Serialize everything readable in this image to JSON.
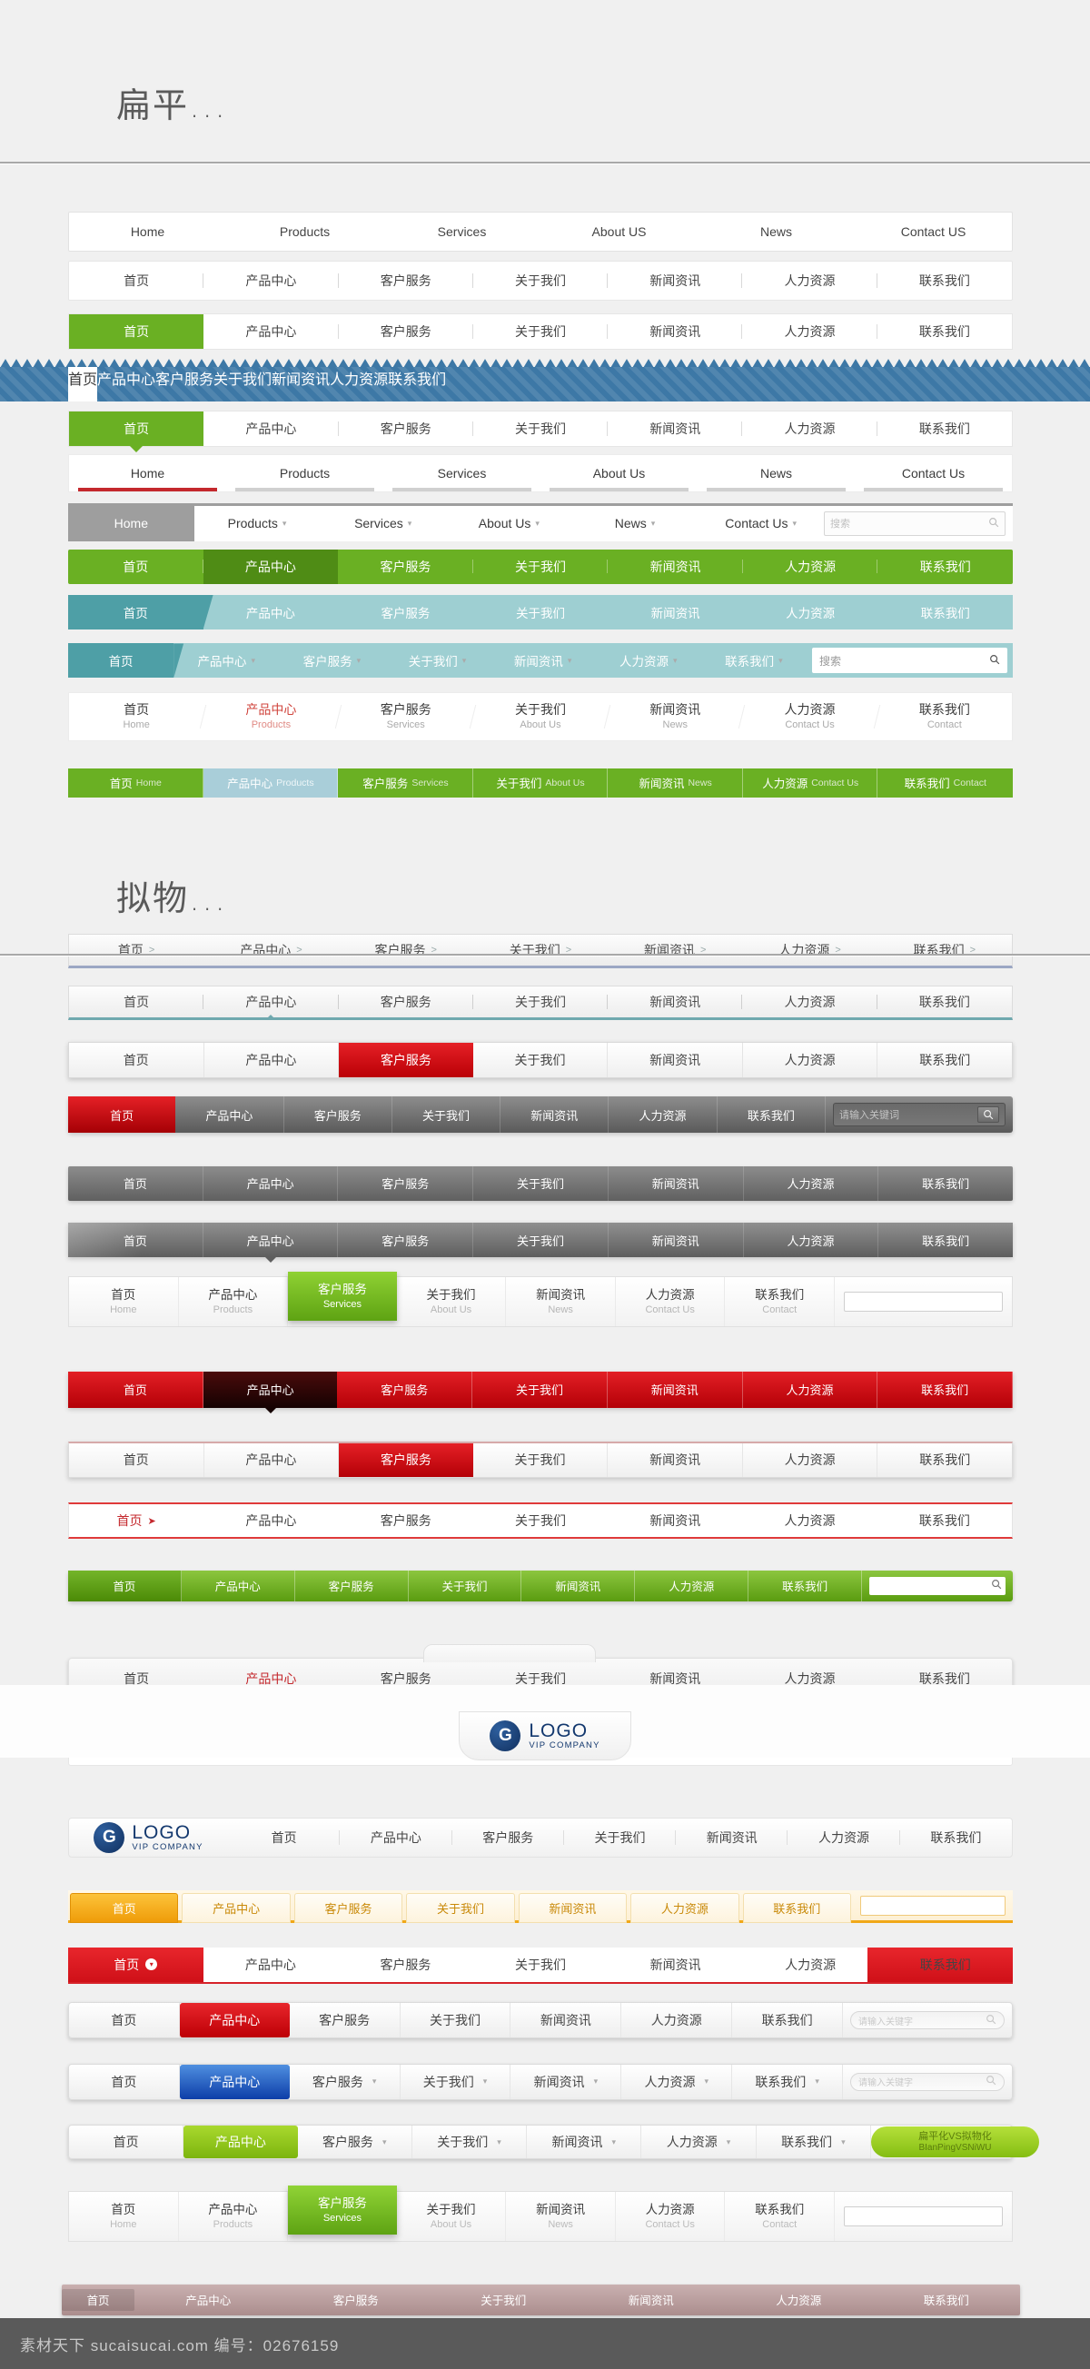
{
  "sections": {
    "flat_heading": "扁平...",
    "skeuo_heading": "拟物..."
  },
  "labels": {
    "zh": [
      "首页",
      "产品中心",
      "客户服务",
      "关于我们",
      "新闻资讯",
      "人力资源",
      "联系我们"
    ],
    "en_us": [
      "Home",
      "Products",
      "Services",
      "About US",
      "News",
      "Contact US"
    ],
    "en_mixed": [
      "Home",
      "Products",
      "Services",
      "About Us",
      "News",
      "Contact Us"
    ],
    "en_sub": [
      "Home",
      "Products",
      "Services",
      "About Us",
      "News",
      "Contact Us",
      "Contact"
    ]
  },
  "navs": [
    {
      "id": "nav-english-plain",
      "style": "n1",
      "items": [
        {
          "zh": "Home"
        },
        {
          "zh": "Products"
        },
        {
          "zh": "Services"
        },
        {
          "zh": "About US"
        },
        {
          "zh": "News"
        },
        {
          "zh": "Contact US"
        }
      ]
    },
    {
      "id": "nav-chinese-divider",
      "style": "n2",
      "items": [
        {
          "zh": "首页"
        },
        {
          "zh": "产品中心"
        },
        {
          "zh": "客户服务"
        },
        {
          "zh": "关于我们"
        },
        {
          "zh": "新闻资讯"
        },
        {
          "zh": "人力资源"
        },
        {
          "zh": "联系我们"
        }
      ]
    },
    {
      "id": "nav-green-active",
      "style": "n3",
      "items": [
        {
          "zh": "首页",
          "active": true
        },
        {
          "zh": "产品中心"
        },
        {
          "zh": "客户服务"
        },
        {
          "zh": "关于我们"
        },
        {
          "zh": "新闻资讯"
        },
        {
          "zh": "人力资源"
        },
        {
          "zh": "联系我们"
        }
      ]
    },
    {
      "id": "nav-blue-zigzag",
      "style": "n4",
      "items": [
        {
          "zh": "首页",
          "active": true
        },
        {
          "zh": "产品中心"
        },
        {
          "zh": "客户服务"
        },
        {
          "zh": "关于我们"
        },
        {
          "zh": "新闻资讯"
        },
        {
          "zh": "人力资源"
        },
        {
          "zh": "联系我们"
        }
      ]
    },
    {
      "id": "nav-green-arrow",
      "style": "n5",
      "items": [
        {
          "zh": "首页",
          "active": true
        },
        {
          "zh": "产品中心"
        },
        {
          "zh": "客户服务"
        },
        {
          "zh": "关于我们"
        },
        {
          "zh": "新闻资讯"
        },
        {
          "zh": "人力资源"
        },
        {
          "zh": "联系我们"
        }
      ]
    },
    {
      "id": "nav-english-underline",
      "style": "n6",
      "items": [
        {
          "zh": "Home",
          "active": true
        },
        {
          "zh": "Products"
        },
        {
          "zh": "Services"
        },
        {
          "zh": "About Us"
        },
        {
          "zh": "News"
        },
        {
          "zh": "Contact Us"
        }
      ]
    },
    {
      "id": "nav-english-dropdown-search",
      "style": "n7",
      "search": {
        "placeholder": "搜索"
      },
      "items": [
        {
          "zh": "Home",
          "active": true
        },
        {
          "zh": "Products",
          "caret": true
        },
        {
          "zh": "Services",
          "caret": true
        },
        {
          "zh": "About Us",
          "caret": true
        },
        {
          "zh": "News",
          "caret": true
        },
        {
          "zh": "Contact Us",
          "caret": true
        }
      ]
    },
    {
      "id": "nav-solid-green",
      "style": "n8",
      "items": [
        {
          "zh": "首页"
        },
        {
          "zh": "产品中心",
          "active": true
        },
        {
          "zh": "客户服务"
        },
        {
          "zh": "关于我们"
        },
        {
          "zh": "新闻资讯"
        },
        {
          "zh": "人力资源"
        },
        {
          "zh": "联系我们"
        }
      ]
    },
    {
      "id": "nav-teal-arrow",
      "style": "n9",
      "items": [
        {
          "zh": "首页",
          "active": true
        },
        {
          "zh": "产品中心"
        },
        {
          "zh": "客户服务"
        },
        {
          "zh": "关于我们"
        },
        {
          "zh": "新闻资讯"
        },
        {
          "zh": "人力资源"
        },
        {
          "zh": "联系我们"
        }
      ]
    },
    {
      "id": "nav-teal-search",
      "style": "n10",
      "search": {
        "placeholder": "搜索"
      },
      "items": [
        {
          "zh": "首页",
          "active": true
        },
        {
          "zh": "产品中心",
          "caret": true
        },
        {
          "zh": "客户服务",
          "caret": true
        },
        {
          "zh": "关于我们",
          "caret": true
        },
        {
          "zh": "新闻资讯",
          "caret": true
        },
        {
          "zh": "人力资源",
          "caret": true
        },
        {
          "zh": "联系我们",
          "caret": true
        }
      ]
    },
    {
      "id": "nav-bilingual-stacked",
      "style": "n11",
      "items": [
        {
          "zh": "首页",
          "en": "Home"
        },
        {
          "zh": "产品中心",
          "en": "Products",
          "active": true
        },
        {
          "zh": "客户服务",
          "en": "Services"
        },
        {
          "zh": "关于我们",
          "en": "About Us"
        },
        {
          "zh": "新闻资讯",
          "en": "News"
        },
        {
          "zh": "人力资源",
          "en": "Contact Us"
        },
        {
          "zh": "联系我们",
          "en": "Contact"
        }
      ]
    },
    {
      "id": "nav-green-bilingual-inline",
      "style": "n12",
      "items": [
        {
          "zh": "首页",
          "en": "Home"
        },
        {
          "zh": "产品中心",
          "en": "Products",
          "active": true
        },
        {
          "zh": "客户服务",
          "en": "Services"
        },
        {
          "zh": "关于我们",
          "en": "About Us"
        },
        {
          "zh": "新闻资讯",
          "en": "News"
        },
        {
          "zh": "人力资源",
          "en": "Contact Us"
        },
        {
          "zh": "联系我们",
          "en": "Contact"
        }
      ]
    },
    {
      "id": "nav-skeuo-chevron",
      "style": "s1",
      "items": [
        {
          "zh": "首页",
          "gt": true
        },
        {
          "zh": "产品中心",
          "gt": true
        },
        {
          "zh": "客户服务",
          "gt": true
        },
        {
          "zh": "关于我们",
          "gt": true
        },
        {
          "zh": "新闻资讯",
          "gt": true
        },
        {
          "zh": "人力资源",
          "gt": true
        },
        {
          "zh": "联系我们",
          "gt": true
        }
      ]
    },
    {
      "id": "nav-skeuo-teal-caret",
      "style": "s2",
      "items": [
        {
          "zh": "首页"
        },
        {
          "zh": "产品中心",
          "active": true
        },
        {
          "zh": "客户服务"
        },
        {
          "zh": "关于我们"
        },
        {
          "zh": "新闻资讯"
        },
        {
          "zh": "人力资源"
        },
        {
          "zh": "联系我们"
        }
      ]
    },
    {
      "id": "nav-skeuo-white-red",
      "style": "s3",
      "items": [
        {
          "zh": "首页"
        },
        {
          "zh": "产品中心"
        },
        {
          "zh": "客户服务",
          "active": true
        },
        {
          "zh": "关于我们"
        },
        {
          "zh": "新闻资讯"
        },
        {
          "zh": "人力资源"
        },
        {
          "zh": "联系我们"
        }
      ]
    },
    {
      "id": "nav-skeuo-dark-red-search",
      "style": "s4",
      "search": {
        "placeholder": "请输入关键词"
      },
      "items": [
        {
          "zh": "首页",
          "active": true
        },
        {
          "zh": "产品中心"
        },
        {
          "zh": "客户服务"
        },
        {
          "zh": "关于我们"
        },
        {
          "zh": "新闻资讯"
        },
        {
          "zh": "人力资源"
        },
        {
          "zh": "联系我们"
        }
      ]
    },
    {
      "id": "nav-skeuo-gray",
      "style": "s5",
      "items": [
        {
          "zh": "首页"
        },
        {
          "zh": "产品中心"
        },
        {
          "zh": "客户服务"
        },
        {
          "zh": "关于我们"
        },
        {
          "zh": "新闻资讯"
        },
        {
          "zh": "人力资源"
        },
        {
          "zh": "联系我们"
        }
      ]
    },
    {
      "id": "nav-skeuo-gray-gloss",
      "style": "s6",
      "items": [
        {
          "zh": "首页"
        },
        {
          "zh": "产品中心",
          "active": true
        },
        {
          "zh": "客户服务"
        },
        {
          "zh": "关于我们"
        },
        {
          "zh": "新闻资讯"
        },
        {
          "zh": "人力资源"
        },
        {
          "zh": "联系我们"
        }
      ]
    },
    {
      "id": "nav-skeuo-bilingual-green",
      "style": "s7",
      "items": [
        {
          "zh": "首页",
          "en": "Home"
        },
        {
          "zh": "产品中心",
          "en": "Products"
        },
        {
          "zh": "客户服务",
          "en": "Services",
          "active": true
        },
        {
          "zh": "关于我们",
          "en": "About Us"
        },
        {
          "zh": "新闻资讯",
          "en": "News"
        },
        {
          "zh": "人力资源",
          "en": "Contact Us"
        },
        {
          "zh": "联系我们",
          "en": "Contact"
        }
      ]
    },
    {
      "id": "nav-skeuo-red-black",
      "style": "s8",
      "items": [
        {
          "zh": "首页"
        },
        {
          "zh": "产品中心",
          "active": true
        },
        {
          "zh": "客户服务"
        },
        {
          "zh": "关于我们"
        },
        {
          "zh": "新闻资讯"
        },
        {
          "zh": "人力资源"
        },
        {
          "zh": "联系我们"
        }
      ]
    },
    {
      "id": "nav-skeuo-white-red2",
      "style": "s9",
      "items": [
        {
          "zh": "首页"
        },
        {
          "zh": "产品中心"
        },
        {
          "zh": "客户服务",
          "active": true
        },
        {
          "zh": "关于我们"
        },
        {
          "zh": "新闻资讯"
        },
        {
          "zh": "人力资源"
        },
        {
          "zh": "联系我们"
        }
      ]
    },
    {
      "id": "nav-skeuo-red-ribbon",
      "style": "s10",
      "items": [
        {
          "zh": "首页",
          "active": true,
          "badge": "➤"
        },
        {
          "zh": "产品中心"
        },
        {
          "zh": "客户服务"
        },
        {
          "zh": "关于我们"
        },
        {
          "zh": "新闻资讯"
        },
        {
          "zh": "人力资源"
        },
        {
          "zh": "联系我们"
        }
      ]
    },
    {
      "id": "nav-skeuo-green-gloss-search",
      "style": "s11",
      "search": {
        "placeholder": ""
      },
      "items": [
        {
          "zh": "首页",
          "active": true
        },
        {
          "zh": "产品中心"
        },
        {
          "zh": "客户服务"
        },
        {
          "zh": "关于我们"
        },
        {
          "zh": "新闻资讯"
        },
        {
          "zh": "人力资源"
        },
        {
          "zh": "联系我们"
        }
      ]
    },
    {
      "id": "nav-skeuo-rounded-tab",
      "style": "s12",
      "items": [
        {
          "zh": "首页"
        },
        {
          "zh": "产品中心",
          "active": true
        },
        {
          "zh": "客户服务"
        },
        {
          "zh": "关于我们"
        },
        {
          "zh": "新闻资讯"
        },
        {
          "zh": "人力资源"
        },
        {
          "zh": "联系我们"
        }
      ]
    },
    {
      "id": "nav-skeuo-logo-center",
      "style": "s13",
      "logo": {
        "name": "LOGO",
        "tagline": "VIP COMPANY",
        "mark": "G"
      },
      "items": [
        {
          "zh": "产品中心",
          "active": true
        },
        {
          "zh": "客户服务"
        },
        {
          "zh": "关于我们"
        },
        {
          "zh": "新闻资讯"
        },
        {
          "zh": "人力资源"
        },
        {
          "zh": "联系我们"
        }
      ]
    },
    {
      "id": "nav-skeuo-logo-left",
      "style": "s14",
      "logo": {
        "name": "LOGO",
        "tagline": "VIP COMPANY",
        "mark": "G"
      },
      "items": [
        {
          "zh": "首页"
        },
        {
          "zh": "产品中心"
        },
        {
          "zh": "客户服务"
        },
        {
          "zh": "关于我们"
        },
        {
          "zh": "新闻资讯"
        },
        {
          "zh": "人力资源"
        },
        {
          "zh": "联系我们"
        }
      ]
    },
    {
      "id": "nav-skeuo-orange-tabs",
      "style": "s15",
      "search": {
        "placeholder": ""
      },
      "items": [
        {
          "zh": "首页",
          "active": true
        },
        {
          "zh": "产品中心"
        },
        {
          "zh": "客户服务"
        },
        {
          "zh": "关于我们"
        },
        {
          "zh": "新闻资讯"
        },
        {
          "zh": "人力资源"
        },
        {
          "zh": "联系我们"
        }
      ]
    },
    {
      "id": "nav-skeuo-red-dot-tab",
      "style": "s16",
      "items": [
        {
          "zh": "首页",
          "active": true,
          "dot": "▾"
        },
        {
          "zh": "产品中心"
        },
        {
          "zh": "客户服务"
        },
        {
          "zh": "关于我们"
        },
        {
          "zh": "新闻资讯"
        },
        {
          "zh": "人力资源"
        },
        {
          "zh": "联系我们"
        }
      ]
    },
    {
      "id": "nav-skeuo-red-active-search",
      "style": "s17",
      "search": {
        "placeholder": "请输入关键字"
      },
      "items": [
        {
          "zh": "首页"
        },
        {
          "zh": "产品中心",
          "active": true
        },
        {
          "zh": "客户服务"
        },
        {
          "zh": "关于我们"
        },
        {
          "zh": "新闻资讯"
        },
        {
          "zh": "人力资源"
        },
        {
          "zh": "联系我们"
        }
      ]
    },
    {
      "id": "nav-skeuo-blue-active-search",
      "style": "s18",
      "search": {
        "placeholder": "请输入关键字"
      },
      "items": [
        {
          "zh": "首页"
        },
        {
          "zh": "产品中心",
          "active": true
        },
        {
          "zh": "客户服务",
          "caret": true
        },
        {
          "zh": "关于我们",
          "caret": true
        },
        {
          "zh": "新闻资讯",
          "caret": true
        },
        {
          "zh": "人力资源",
          "caret": true
        },
        {
          "zh": "联系我们",
          "caret": true
        }
      ]
    },
    {
      "id": "nav-skeuo-green-pill",
      "style": "s19",
      "pill": {
        "line1": "扁平化VS拟物化",
        "line2": "BIanPingVSNiWU"
      },
      "items": [
        {
          "zh": "首页"
        },
        {
          "zh": "产品中心",
          "active": true
        },
        {
          "zh": "客户服务",
          "caret": true
        },
        {
          "zh": "关于我们",
          "caret": true
        },
        {
          "zh": "新闻资讯",
          "caret": true
        },
        {
          "zh": "人力资源",
          "caret": true
        },
        {
          "zh": "联系我们",
          "caret": true
        }
      ]
    },
    {
      "id": "nav-skeuo-bilingual-green2",
      "style": "s20",
      "items": [
        {
          "zh": "首页",
          "en": "Home"
        },
        {
          "zh": "产品中心",
          "en": "Products"
        },
        {
          "zh": "客户服务",
          "en": "Services",
          "active": true
        },
        {
          "zh": "关于我们",
          "en": "About Us"
        },
        {
          "zh": "新闻资讯",
          "en": "News"
        },
        {
          "zh": "人力资源",
          "en": "Contact Us"
        },
        {
          "zh": "联系我们",
          "en": "Contact"
        }
      ]
    },
    {
      "id": "nav-skeuo-mauve-ribbon",
      "style": "s21",
      "items": [
        {
          "zh": "首页",
          "active": true
        },
        {
          "zh": "产品中心"
        },
        {
          "zh": "客户服务"
        },
        {
          "zh": "关于我们"
        },
        {
          "zh": "新闻资讯"
        },
        {
          "zh": "人力资源"
        },
        {
          "zh": "联系我们"
        }
      ]
    }
  ],
  "footer": {
    "watermark": "素材天下 sucaisucai.com  编号：02676159"
  },
  "colors": {
    "green": "#6ab023",
    "blue": "#3d78a6",
    "teal": "#4e9fa6",
    "red": "#c4282d",
    "orange": "#ef9c09",
    "mauve": "#ab8d8d"
  }
}
